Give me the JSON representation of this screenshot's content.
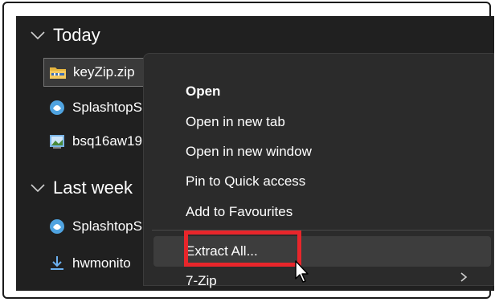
{
  "groups": [
    {
      "label": "Today",
      "icon": "chevron-down-icon"
    },
    {
      "label": "Last week",
      "icon": "chevron-down-icon"
    }
  ],
  "files": [
    {
      "name": "keyZip.zip",
      "icon": "zip-folder-icon",
      "selected": true
    },
    {
      "name": "SplashtopS",
      "icon": "splashtop-icon"
    },
    {
      "name": "bsq16aw19",
      "icon": "installer-image-icon"
    },
    {
      "name": "SplashtopS",
      "icon": "splashtop-icon"
    },
    {
      "name": "hwmonito",
      "icon": "download-icon"
    }
  ],
  "context_menu": {
    "items": [
      {
        "label": "Open",
        "bold": true
      },
      {
        "label": "Open in new tab"
      },
      {
        "label": "Open in new window"
      },
      {
        "label": "Pin to Quick access"
      },
      {
        "label": "Add to Favourites"
      },
      {
        "label": "Extract All...",
        "highlighted": true
      },
      {
        "label": "7-Zip",
        "has_submenu": true
      }
    ]
  },
  "colors": {
    "highlight_box": "#e8262b",
    "background": "#202020",
    "menu_background": "#2b2b2b"
  }
}
